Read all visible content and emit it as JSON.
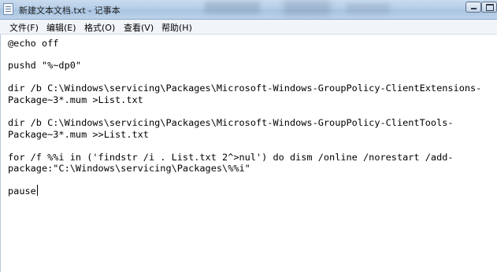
{
  "window": {
    "title": "新建文本文档.txt - 记事本",
    "icon": "notepad-icon"
  },
  "menu": {
    "items": [
      "文件(F)",
      "编辑(E)",
      "格式(O)",
      "查看(V)",
      "帮助(H)"
    ]
  },
  "editor": {
    "lines": [
      "@echo off",
      "pushd \"%~dp0\"",
      "dir /b C:\\Windows\\servicing\\Packages\\Microsoft-Windows-GroupPolicy-ClientExtensions-",
      "Package~3*.mum >List.txt",
      "dir /b C:\\Windows\\servicing\\Packages\\Microsoft-Windows-GroupPolicy-ClientTools-",
      "Package~3*.mum >>List.txt",
      "for /f %%i in ('findstr /i . List.txt 2^>nul') do dism /online /norestart /add-",
      "package:\"C:\\Windows\\servicing\\Packages\\%%i\"",
      "pause"
    ]
  },
  "colors": {
    "titlebar": "#b5cde6",
    "menubar": "#f1f4f9",
    "editor_bg": "#ffffff"
  }
}
